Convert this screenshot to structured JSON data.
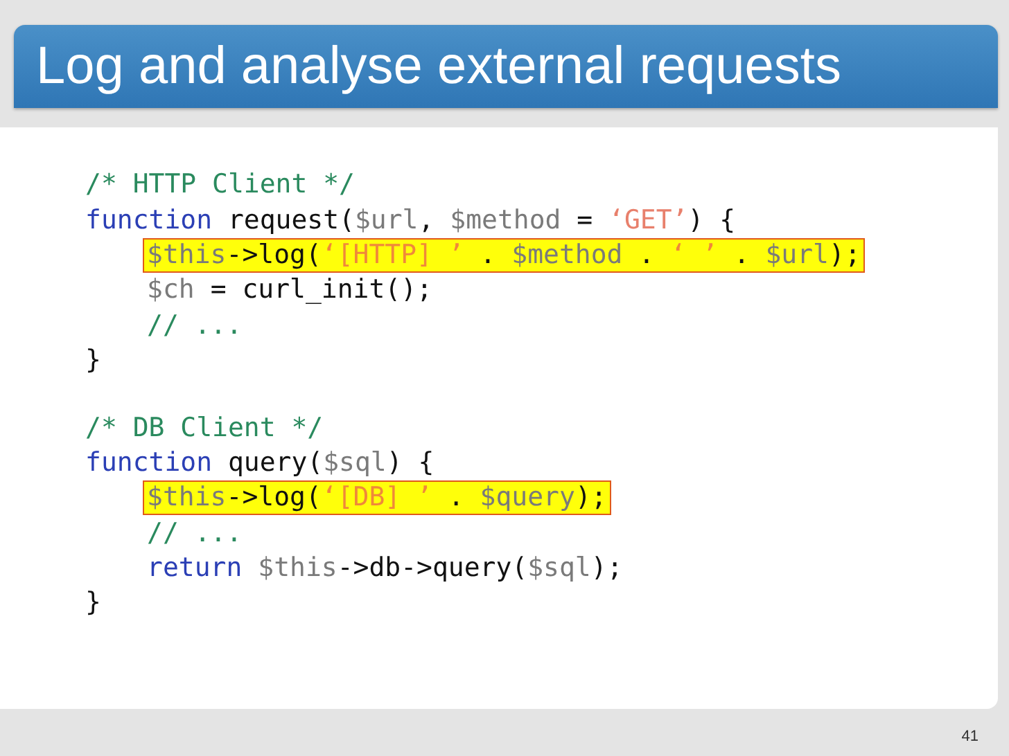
{
  "slide": {
    "title": "Log and analyse external requests",
    "page_number": "41"
  },
  "code_blocks": [
    {
      "lines": [
        {
          "highlighted": false,
          "tokens": [
            {
              "kind": "comment",
              "text": "/* HTTP Client */"
            }
          ]
        },
        {
          "highlighted": false,
          "tokens": [
            {
              "kind": "keyword",
              "text": "function"
            },
            {
              "kind": "plain",
              "text": " request("
            },
            {
              "kind": "variable",
              "text": "$url"
            },
            {
              "kind": "plain",
              "text": ", "
            },
            {
              "kind": "variable",
              "text": "$method"
            },
            {
              "kind": "plain",
              "text": " = "
            },
            {
              "kind": "string",
              "text": "‘GET’"
            },
            {
              "kind": "plain",
              "text": ") {"
            }
          ],
          "children": [
            {
              "highlighted": true,
              "tokens": [
                {
                  "kind": "variable",
                  "text": "$this"
                },
                {
                  "kind": "plain",
                  "text": "->log("
                },
                {
                  "kind": "string",
                  "text": "‘[HTTP] ’"
                },
                {
                  "kind": "plain",
                  "text": " . "
                },
                {
                  "kind": "variable",
                  "text": "$method"
                },
                {
                  "kind": "plain",
                  "text": " . "
                },
                {
                  "kind": "string",
                  "text": "‘ ’"
                },
                {
                  "kind": "plain",
                  "text": " . "
                },
                {
                  "kind": "variable",
                  "text": "$url"
                },
                {
                  "kind": "plain",
                  "text": ");"
                }
              ]
            },
            {
              "highlighted": false,
              "tokens": [
                {
                  "kind": "variable",
                  "text": "$ch"
                },
                {
                  "kind": "plain",
                  "text": " = curl_init();"
                }
              ]
            },
            {
              "highlighted": false,
              "tokens": [
                {
                  "kind": "comment",
                  "text": "// ..."
                }
              ]
            }
          ]
        },
        {
          "highlighted": false,
          "tokens": [
            {
              "kind": "plain",
              "text": "}"
            }
          ]
        }
      ]
    },
    {
      "lines": [
        {
          "highlighted": false,
          "tokens": [
            {
              "kind": "comment",
              "text": "/* DB Client */"
            }
          ]
        },
        {
          "highlighted": false,
          "tokens": [
            {
              "kind": "keyword",
              "text": "function"
            },
            {
              "kind": "plain",
              "text": " query("
            },
            {
              "kind": "variable",
              "text": "$sql"
            },
            {
              "kind": "plain",
              "text": ") {"
            }
          ],
          "children": [
            {
              "highlighted": true,
              "tokens": [
                {
                  "kind": "variable",
                  "text": "$this"
                },
                {
                  "kind": "plain",
                  "text": "->log("
                },
                {
                  "kind": "string",
                  "text": "‘[DB] ’"
                },
                {
                  "kind": "plain",
                  "text": " . "
                },
                {
                  "kind": "variable",
                  "text": "$query"
                },
                {
                  "kind": "plain",
                  "text": ");"
                }
              ]
            },
            {
              "highlighted": false,
              "tokens": [
                {
                  "kind": "comment",
                  "text": "// ..."
                }
              ]
            },
            {
              "highlighted": false,
              "tokens": [
                {
                  "kind": "keyword",
                  "text": "return "
                },
                {
                  "kind": "variable",
                  "text": "$this"
                },
                {
                  "kind": "plain",
                  "text": "->db->query("
                },
                {
                  "kind": "variable",
                  "text": "$sql"
                },
                {
                  "kind": "plain",
                  "text": ");"
                }
              ]
            }
          ]
        },
        {
          "highlighted": false,
          "tokens": [
            {
              "kind": "plain",
              "text": "}"
            }
          ]
        }
      ]
    }
  ]
}
